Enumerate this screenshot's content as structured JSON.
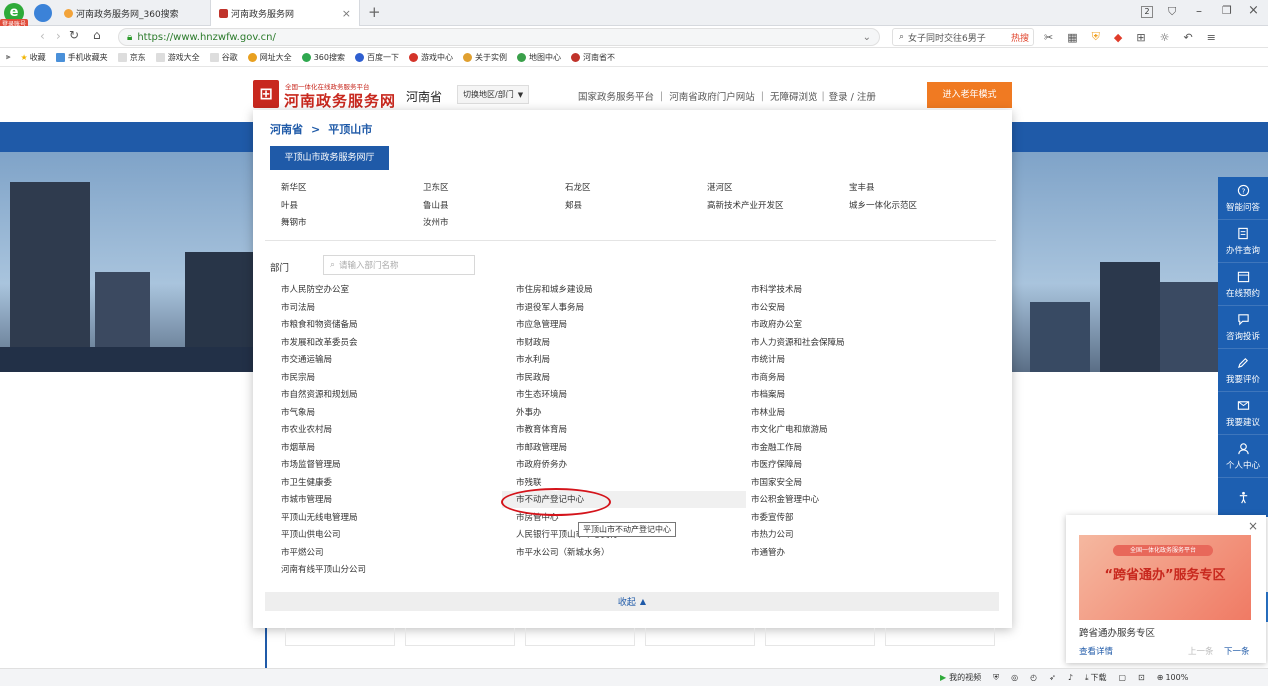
{
  "browser": {
    "tabs": [
      {
        "label": "河南政务服务网_360搜索",
        "active": false
      },
      {
        "label": "河南政务服务网",
        "active": true
      }
    ],
    "login_badge": "登录账号",
    "url": "https://www.hnzwfw.gov.cn/",
    "search_text": "女子同时交往6男子",
    "search_hot": "热搜",
    "tab_count": "2",
    "bookmarks": [
      "收藏",
      "手机收藏夹",
      "京东",
      "游戏大全",
      "谷歌",
      "网址大全",
      "360搜索",
      "百度一下",
      "游戏中心",
      "关于实例",
      "地图中心",
      "河南省不"
    ]
  },
  "header": {
    "logo_small": "全国一体化在线政务服务平台",
    "logo_big": "河南政务服务网",
    "province": "河南省",
    "switch_label": "切换地区/部门",
    "links": [
      "国家政务服务平台",
      "河南省政府门户网站",
      "无障碍浏览",
      "登录 / 注册"
    ],
    "elder_button": "进入老年模式"
  },
  "panel": {
    "breadcrumb": [
      "河南省",
      ">",
      "平顶山市"
    ],
    "hall_button": "平顶山市政务服务网厅",
    "districts": [
      "新华区",
      "卫东区",
      "石龙区",
      "湛河区",
      "宝丰县",
      "叶县",
      "鲁山县",
      "郏县",
      "高新技术产业开发区",
      "城乡一体化示范区",
      "舞钢市",
      "汝州市"
    ],
    "dept_label": "部门",
    "dept_placeholder": "请输入部门名称",
    "departments": [
      "市人民防空办公室",
      "市住房和城乡建设局",
      "市科学技术局",
      "市司法局",
      "市退役军人事务局",
      "市公安局",
      "市粮食和物资储备局",
      "市应急管理局",
      "市政府办公室",
      "市发展和改革委员会",
      "市财政局",
      "市人力资源和社会保障局",
      "市交通运输局",
      "市水利局",
      "市统计局",
      "市民宗局",
      "市民政局",
      "市商务局",
      "市自然资源和规划局",
      "市生态环境局",
      "市档案局",
      "市气象局",
      "外事办",
      "市林业局",
      "市农业农村局",
      "市教育体育局",
      "市文化广电和旅游局",
      "市烟草局",
      "市邮政管理局",
      "市金融工作局",
      "市场监督管理局",
      "市政府侨务办",
      "市医疗保障局",
      "市卫生健康委",
      "市残联",
      "市国家安全局",
      "市城市管理局",
      "市不动产登记中心",
      "市公积金管理中心",
      "平顶山无线电管理局",
      "市房管中心",
      "市委宣传部",
      "平顶山供电公司",
      "人民银行平顶山市中心支行",
      "市热力公司",
      "市平燃公司",
      "市平水公司（新城水务）",
      "市通管办",
      "河南有线平顶山分公司",
      "",
      ""
    ],
    "tooltip": "平顶山市不动产登记中心",
    "collapse_label": "收起"
  },
  "right_sidebar": [
    "智能问答",
    "办件查询",
    "在线预约",
    "咨询投诉",
    "我要评价",
    "我要建议",
    "个人中心"
  ],
  "popup": {
    "banner_small": "全国一体化政务服务平台",
    "banner_big": "“跨省通办”服务专区",
    "title": "跨省通办服务专区",
    "detail_link": "查看详情",
    "prev": "上一条",
    "next": "下一条"
  },
  "statusbar": {
    "video": "我的视频",
    "download": "下载",
    "zoom": "100%"
  }
}
